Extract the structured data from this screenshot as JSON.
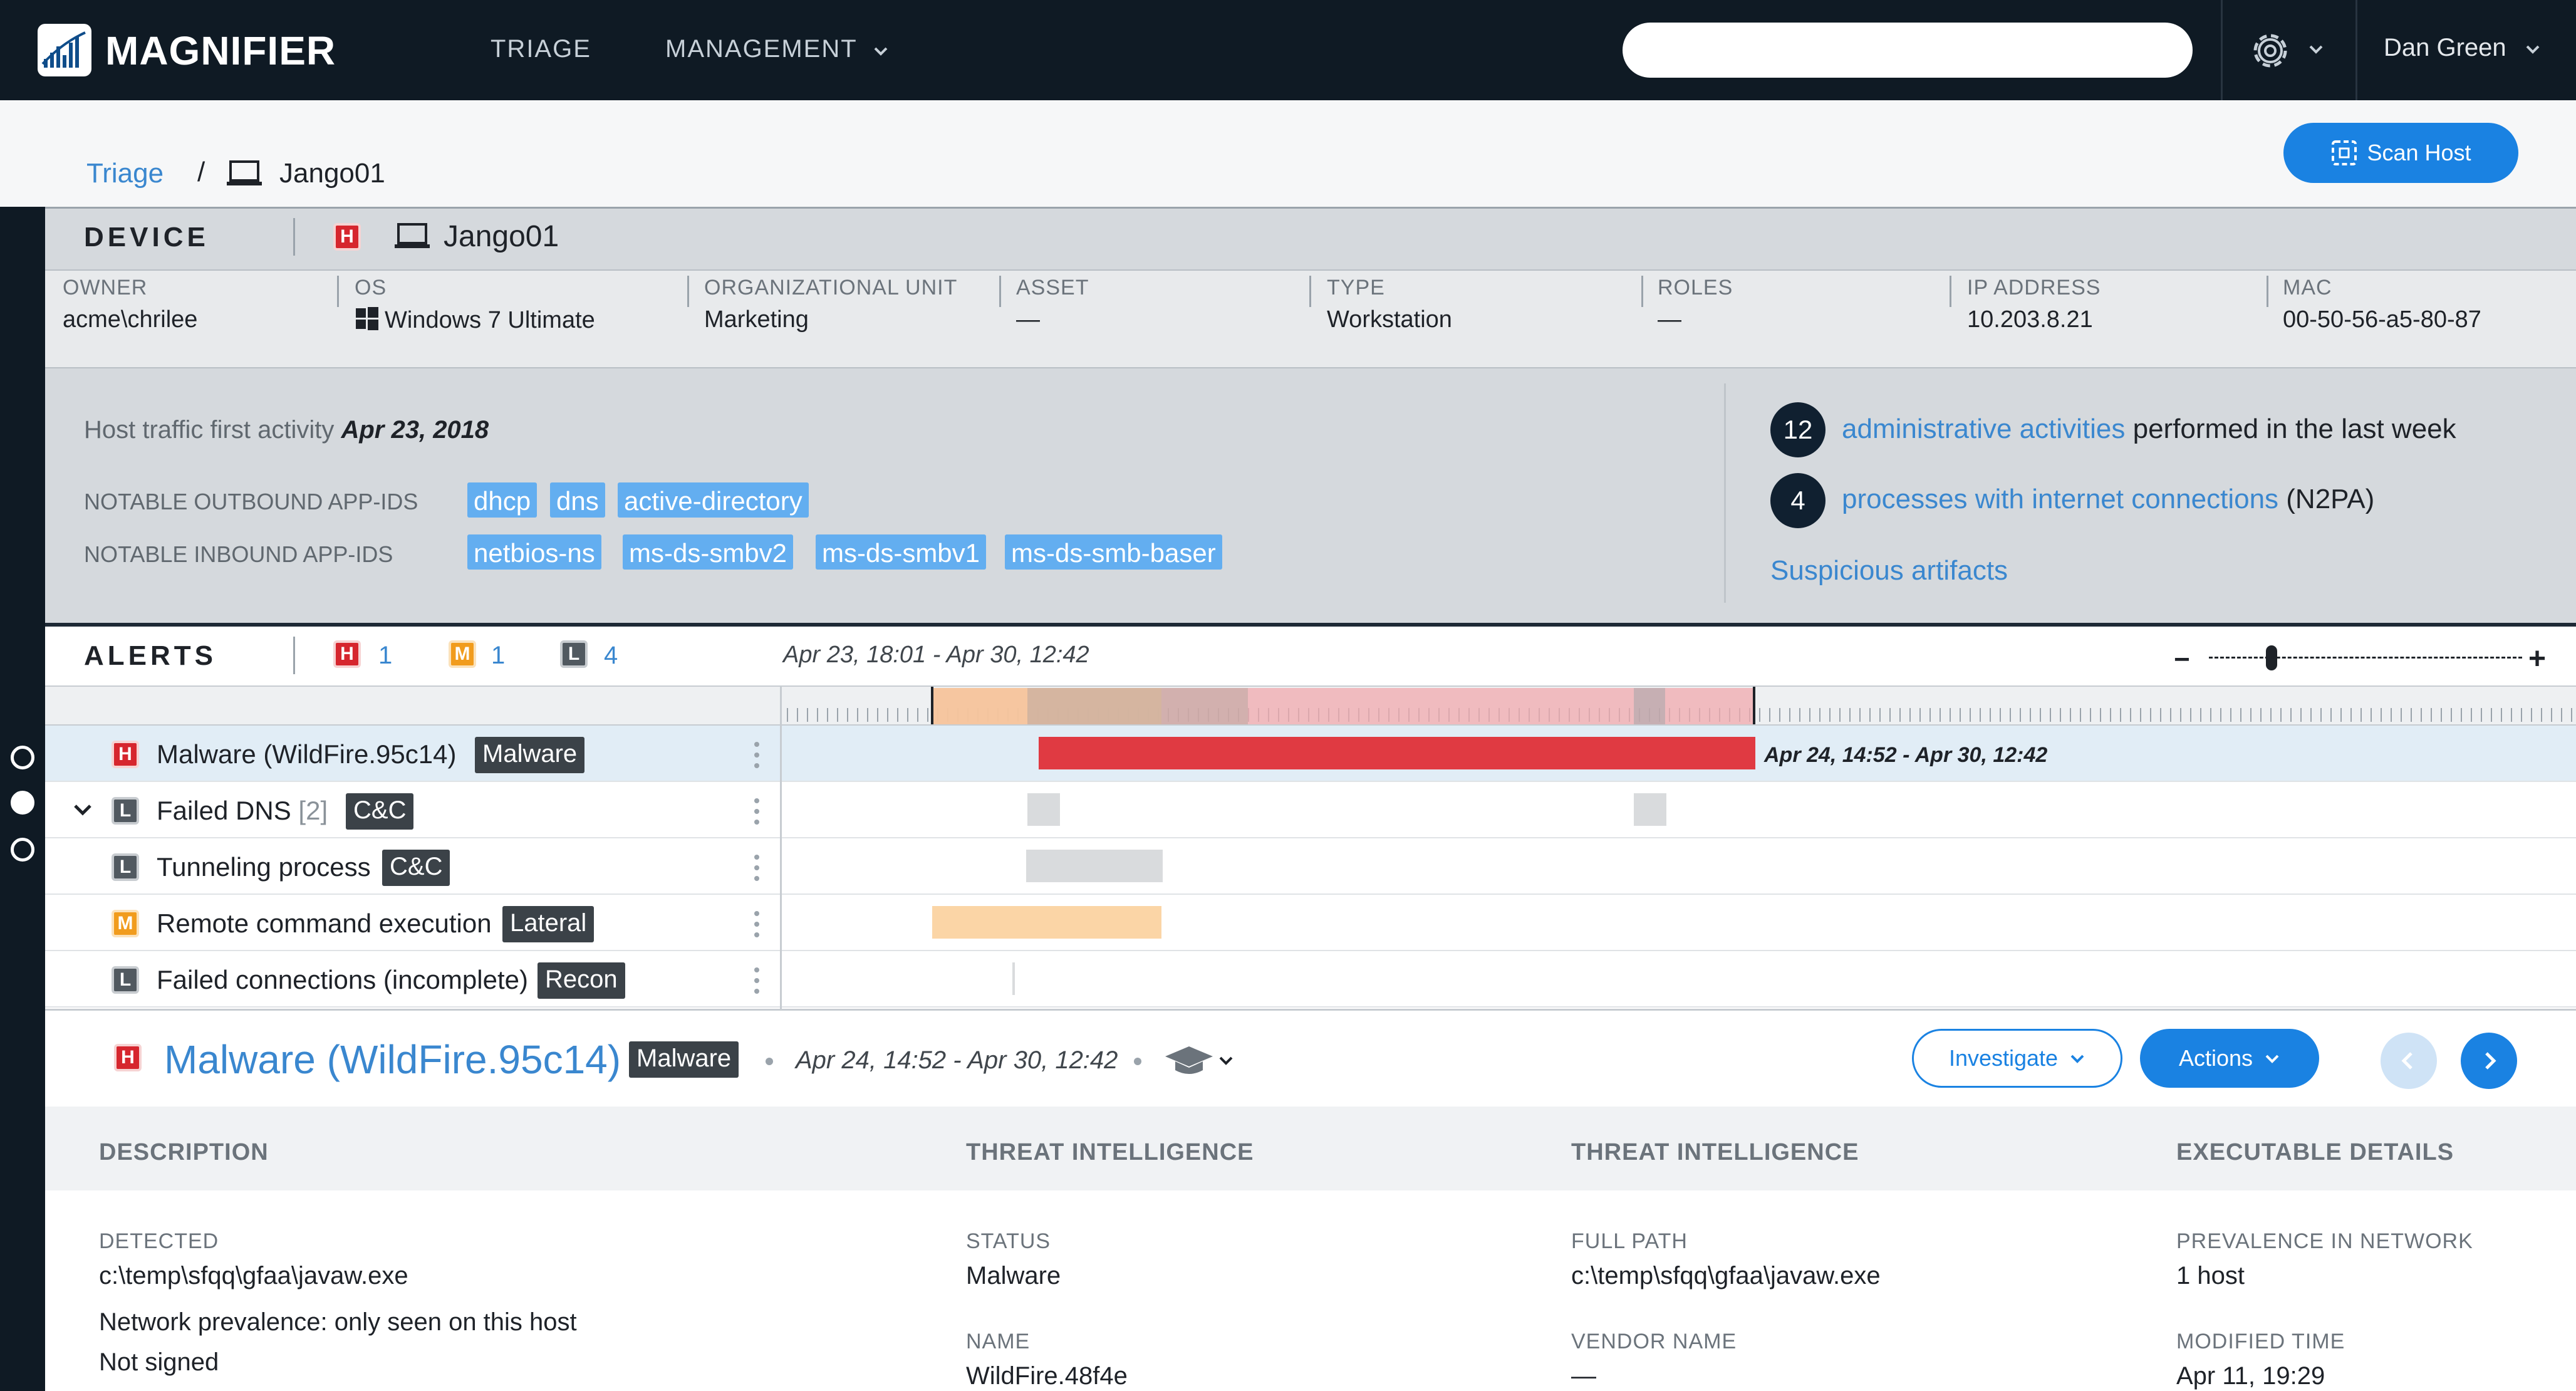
{
  "app": {
    "name": "MAGNIFIER"
  },
  "nav": {
    "triage": "TRIAGE",
    "management": "MANAGEMENT"
  },
  "search": {
    "placeholder": ""
  },
  "user": {
    "name": "Dan Green"
  },
  "breadcrumb": {
    "root": "Triage",
    "separator": "/",
    "host": "Jango01"
  },
  "scan_button": "Scan Host",
  "device": {
    "heading": "DEVICE",
    "severity": "H",
    "name": "Jango01",
    "fields": [
      {
        "label": "OWNER",
        "value": "acme\\chrilee"
      },
      {
        "label": "OS",
        "value": "Windows 7 Ultimate"
      },
      {
        "label": "ORGANIZATIONAL UNIT",
        "value": "Marketing"
      },
      {
        "label": "ASSET",
        "value": "—"
      },
      {
        "label": "TYPE",
        "value": "Workstation"
      },
      {
        "label": "ROLES",
        "value": "—"
      },
      {
        "label": "IP ADDRESS",
        "value": "10.203.8.21"
      },
      {
        "label": "MAC",
        "value": "00-50-56-a5-80-87"
      }
    ]
  },
  "traffic": {
    "first_activity_label": "Host traffic first activity",
    "first_activity_date": "Apr 23, 2018",
    "outbound_label": "NOTABLE OUTBOUND APP-IDS",
    "outbound": [
      "dhcp",
      "dns",
      "active-directory"
    ],
    "inbound_label": "NOTABLE INBOUND APP-IDS",
    "inbound": [
      "netbios-ns",
      "ms-ds-smbv2",
      "ms-ds-smbv1",
      "ms-ds-smb-baser"
    ],
    "admin_count": "12",
    "admin_link": "administrative activities",
    "admin_suffix": "performed in the last week",
    "process_count": "4",
    "process_link": "processes with internet connections",
    "process_suffix": "(N2PA)",
    "suspicious_link": "Suspicious artifacts"
  },
  "alerts": {
    "heading": "ALERTS",
    "counts": [
      {
        "sev": "H",
        "count": "1"
      },
      {
        "sev": "M",
        "count": "1"
      },
      {
        "sev": "L",
        "count": "4"
      }
    ],
    "range": "Apr 23, 18:01 - Apr 30, 12:42",
    "zoom": {
      "minus": "−",
      "plus": "+",
      "level": 0.2
    },
    "rows": [
      {
        "sev": "H",
        "title": "Malware (WildFire.95c14)",
        "tag": "Malware",
        "bar_label": "Apr 24, 14:52 - Apr 30, 12:42"
      },
      {
        "sev": "L",
        "title": "Failed DNS",
        "count": "[2]",
        "tag": "C&C"
      },
      {
        "sev": "L",
        "title": "Tunneling process",
        "tag": "C&C"
      },
      {
        "sev": "M",
        "title": "Remote command execution",
        "tag": "Lateral"
      },
      {
        "sev": "L",
        "title": "Failed connections (incomplete)",
        "tag": "Recon"
      }
    ]
  },
  "detail": {
    "severity": "H",
    "title": "Malware (WildFire.95c14)",
    "tag": "Malware",
    "time": "Apr 24, 14:52 - Apr 30, 12:42",
    "investigate": "Investigate",
    "actions": "Actions",
    "columns": [
      "DESCRIPTION",
      "THREAT INTELLIGENCE",
      "THREAT INTELLIGENCE",
      "EXECUTABLE DETAILS"
    ],
    "description": {
      "label": "DETECTED",
      "value": "c:\\temp\\sfqq\\gfaa\\javaw.exe",
      "line2": "Network prevalence: only seen on this host",
      "line3": "Not signed"
    },
    "ti1": {
      "status_label": "STATUS",
      "status": "Malware",
      "name_label": "NAME",
      "name": "WildFire.48f4e"
    },
    "ti2": {
      "path_label": "FULL PATH",
      "path": "c:\\temp\\sfqq\\gfaa\\javaw.exe",
      "vendor_label": "VENDOR NAME",
      "vendor": "—"
    },
    "exe": {
      "prev_label": "PREVALENCE IN NETWORK",
      "prev": "1 host",
      "mod_label": "MODIFIED TIME",
      "mod": "Apr 11, 19:29"
    }
  },
  "colors": {
    "high": "#d6262e",
    "medium": "#f19c1d",
    "low": "#515960",
    "accent": "#1a82e2",
    "link": "#3a87cf",
    "nav_bg": "#0f1a24"
  }
}
